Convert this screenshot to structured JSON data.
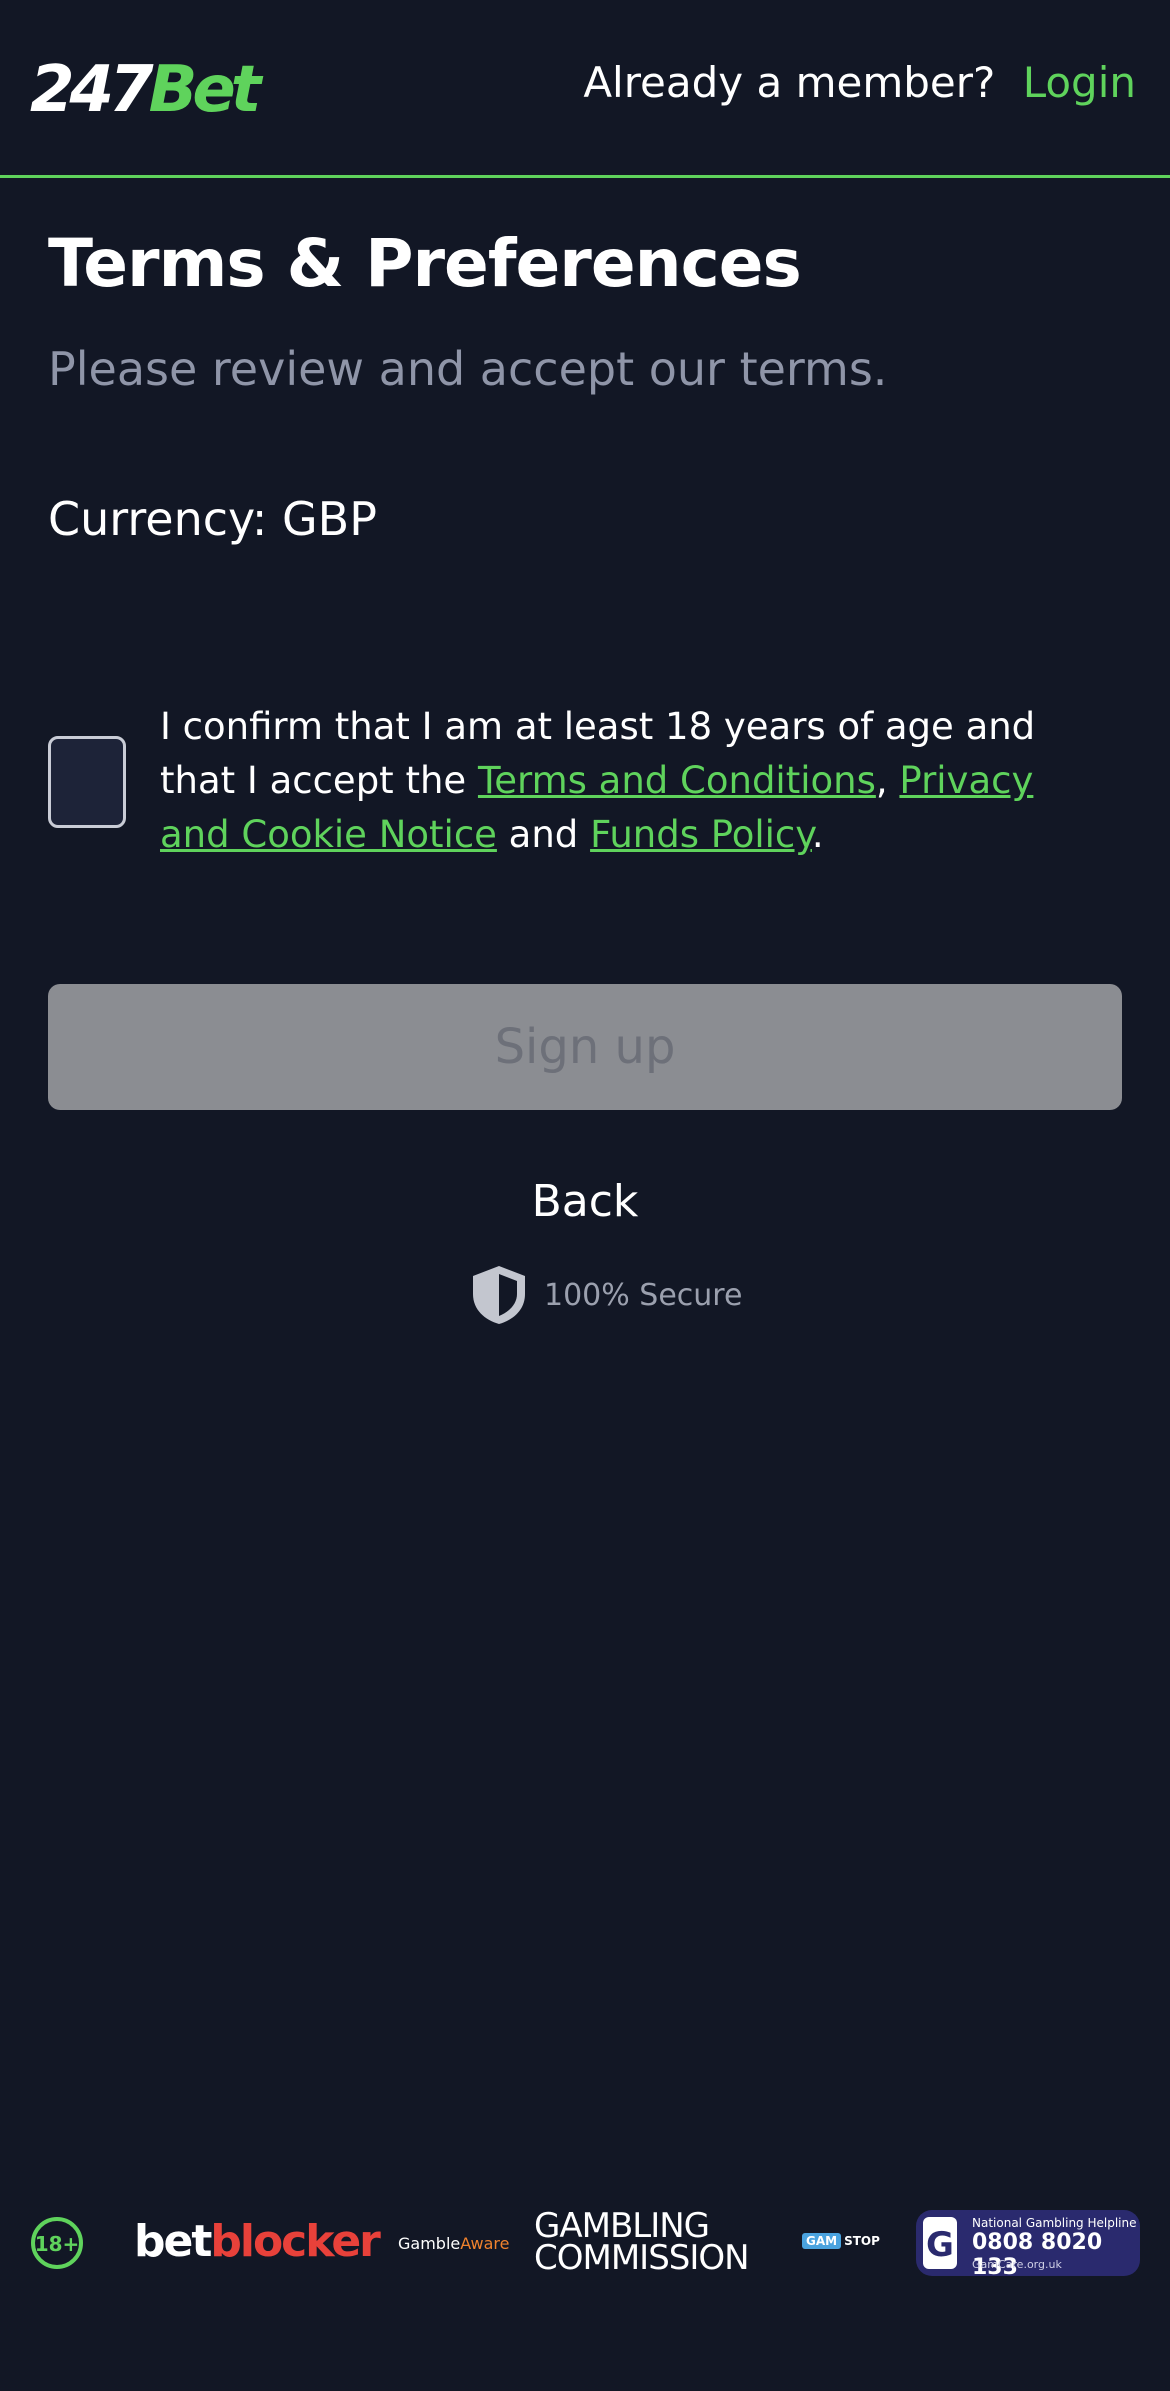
{
  "header": {
    "logo_number": "247",
    "logo_brand": "Bet",
    "member_question": "Already a member?",
    "login_label": "Login"
  },
  "main": {
    "title": "Terms & Preferences",
    "subtitle": "Please review and accept our terms.",
    "currency": "Currency: GBP",
    "consent": {
      "part1": "I confirm that I am at least 18 years of age and that I accept the ",
      "terms_link": "Terms and Conditions",
      "sep1": ", ",
      "privacy_link": "Privacy and Cookie Notice",
      "sep2": " and ",
      "funds_link": "Funds Policy",
      "end": ".",
      "checked": false
    },
    "signup_label": "Sign up",
    "signup_enabled": false,
    "back_label": "Back",
    "secure_label": "100% Secure"
  },
  "footer": {
    "age_badge": "18+",
    "betblocker_1": "bet",
    "betblocker_2": "blocker",
    "gambleaware_1": "Gamble",
    "gambleaware_2": "Aware",
    "gc_line1": "GAMBLING",
    "gc_line2": "COMMISSION",
    "gamstop_1": "GAM",
    "gamstop_2": "STOP",
    "gamcare_line1": "National Gambling Helpline",
    "gamcare_phone": "0808 8020 133",
    "gamcare_site": "GamCare.org.uk"
  },
  "colors": {
    "background": "#121725",
    "accent": "#5fd35c",
    "button_disabled": "#8b8d92",
    "muted_text": "#8f95a8"
  },
  "icons": [
    "shield-icon",
    "age-18-icon",
    "gamcare-g-icon"
  ]
}
